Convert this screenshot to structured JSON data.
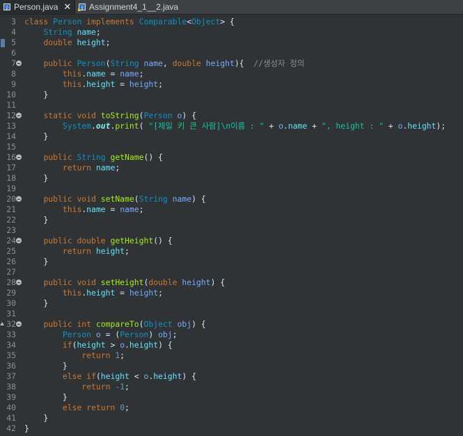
{
  "tabs": [
    {
      "label": "Person.java",
      "icon": "java-file-icon",
      "active": true,
      "close": "✕"
    },
    {
      "label": "Assignment4_1__2.java",
      "icon": "java-file-icon",
      "active": false
    }
  ],
  "lines": [
    {
      "n": "3",
      "parts": [
        [
          "kw",
          "class "
        ],
        [
          "type",
          "Person "
        ],
        [
          "kw",
          "implements "
        ],
        [
          "type",
          "Comparable"
        ],
        [
          "plain",
          "<"
        ],
        [
          "type",
          "Object"
        ],
        [
          "plain",
          "> {"
        ]
      ]
    },
    {
      "n": "4",
      "parts": [
        [
          "plain",
          "    "
        ],
        [
          "type",
          "String "
        ],
        [
          "fld",
          "name"
        ],
        [
          "plain",
          ";"
        ]
      ]
    },
    {
      "n": "5",
      "marker": true,
      "parts": [
        [
          "plain",
          "    "
        ],
        [
          "kw",
          "double "
        ],
        [
          "fld",
          "height"
        ],
        [
          "plain",
          ";"
        ]
      ]
    },
    {
      "n": "6",
      "parts": []
    },
    {
      "n": "7",
      "fold": true,
      "parts": [
        [
          "plain",
          "    "
        ],
        [
          "kw",
          "public "
        ],
        [
          "type",
          "Person"
        ],
        [
          "plain",
          "("
        ],
        [
          "type",
          "String "
        ],
        [
          "var",
          "name"
        ],
        [
          "plain",
          ", "
        ],
        [
          "kw",
          "double "
        ],
        [
          "var",
          "height"
        ],
        [
          "plain",
          "){  "
        ],
        [
          "cmt",
          "//생성자 정의"
        ]
      ]
    },
    {
      "n": "8",
      "parts": [
        [
          "plain",
          "        "
        ],
        [
          "kw",
          "this"
        ],
        [
          "plain",
          "."
        ],
        [
          "fld",
          "name"
        ],
        [
          "plain",
          " = "
        ],
        [
          "var",
          "name"
        ],
        [
          "plain",
          ";"
        ]
      ]
    },
    {
      "n": "9",
      "parts": [
        [
          "plain",
          "        "
        ],
        [
          "kw",
          "this"
        ],
        [
          "plain",
          "."
        ],
        [
          "fld",
          "height"
        ],
        [
          "plain",
          " = "
        ],
        [
          "var",
          "height"
        ],
        [
          "plain",
          ";"
        ]
      ]
    },
    {
      "n": "10",
      "parts": [
        [
          "plain",
          "    }"
        ]
      ]
    },
    {
      "n": "11",
      "parts": []
    },
    {
      "n": "12",
      "fold": true,
      "parts": [
        [
          "plain",
          "    "
        ],
        [
          "kw",
          "static "
        ],
        [
          "kw",
          "void "
        ],
        [
          "mth",
          "toString"
        ],
        [
          "plain",
          "("
        ],
        [
          "type",
          "Person "
        ],
        [
          "var",
          "o"
        ],
        [
          "plain",
          ") {"
        ]
      ]
    },
    {
      "n": "13",
      "parts": [
        [
          "plain",
          "        "
        ],
        [
          "type",
          "System"
        ],
        [
          "plain",
          "."
        ],
        [
          "it",
          "out"
        ],
        [
          "plain",
          "."
        ],
        [
          "mth",
          "print"
        ],
        [
          "plain",
          "( "
        ],
        [
          "str",
          "\"[제일 키 큰 사람]\\n이름 : \""
        ],
        [
          "plain",
          " + "
        ],
        [
          "var",
          "o"
        ],
        [
          "plain",
          "."
        ],
        [
          "fld",
          "name"
        ],
        [
          "plain",
          " + "
        ],
        [
          "str",
          "\", height : \""
        ],
        [
          "plain",
          " + "
        ],
        [
          "var",
          "o"
        ],
        [
          "plain",
          "."
        ],
        [
          "fld",
          "height"
        ],
        [
          "plain",
          ");"
        ]
      ]
    },
    {
      "n": "14",
      "parts": [
        [
          "plain",
          "    }"
        ]
      ]
    },
    {
      "n": "15",
      "parts": []
    },
    {
      "n": "16",
      "fold": true,
      "parts": [
        [
          "plain",
          "    "
        ],
        [
          "kw",
          "public "
        ],
        [
          "type",
          "String "
        ],
        [
          "mth",
          "getName"
        ],
        [
          "plain",
          "() {"
        ]
      ]
    },
    {
      "n": "17",
      "parts": [
        [
          "plain",
          "        "
        ],
        [
          "kw",
          "return "
        ],
        [
          "fld",
          "name"
        ],
        [
          "plain",
          ";"
        ]
      ]
    },
    {
      "n": "18",
      "parts": [
        [
          "plain",
          "    }"
        ]
      ]
    },
    {
      "n": "19",
      "parts": []
    },
    {
      "n": "20",
      "fold": true,
      "parts": [
        [
          "plain",
          "    "
        ],
        [
          "kw",
          "public "
        ],
        [
          "kw",
          "void "
        ],
        [
          "mth",
          "setName"
        ],
        [
          "plain",
          "("
        ],
        [
          "type",
          "String "
        ],
        [
          "var",
          "name"
        ],
        [
          "plain",
          ") {"
        ]
      ]
    },
    {
      "n": "21",
      "parts": [
        [
          "plain",
          "        "
        ],
        [
          "kw",
          "this"
        ],
        [
          "plain",
          "."
        ],
        [
          "fld",
          "name"
        ],
        [
          "plain",
          " = "
        ],
        [
          "var",
          "name"
        ],
        [
          "plain",
          ";"
        ]
      ]
    },
    {
      "n": "22",
      "parts": [
        [
          "plain",
          "    }"
        ]
      ]
    },
    {
      "n": "23",
      "parts": []
    },
    {
      "n": "24",
      "fold": true,
      "parts": [
        [
          "plain",
          "    "
        ],
        [
          "kw",
          "public "
        ],
        [
          "kw",
          "double "
        ],
        [
          "mth",
          "getHeight"
        ],
        [
          "plain",
          "() {"
        ]
      ]
    },
    {
      "n": "25",
      "parts": [
        [
          "plain",
          "        "
        ],
        [
          "kw",
          "return "
        ],
        [
          "fld",
          "height"
        ],
        [
          "plain",
          ";"
        ]
      ]
    },
    {
      "n": "26",
      "parts": [
        [
          "plain",
          "    }"
        ]
      ]
    },
    {
      "n": "27",
      "parts": []
    },
    {
      "n": "28",
      "fold": true,
      "parts": [
        [
          "plain",
          "    "
        ],
        [
          "kw",
          "public "
        ],
        [
          "kw",
          "void "
        ],
        [
          "mth",
          "setHeight"
        ],
        [
          "plain",
          "("
        ],
        [
          "kw",
          "double "
        ],
        [
          "var",
          "height"
        ],
        [
          "plain",
          ") {"
        ]
      ]
    },
    {
      "n": "29",
      "parts": [
        [
          "plain",
          "        "
        ],
        [
          "kw",
          "this"
        ],
        [
          "plain",
          "."
        ],
        [
          "fld",
          "height"
        ],
        [
          "plain",
          " = "
        ],
        [
          "var",
          "height"
        ],
        [
          "plain",
          ";"
        ]
      ]
    },
    {
      "n": "30",
      "parts": [
        [
          "plain",
          "    }"
        ]
      ]
    },
    {
      "n": "31",
      "parts": []
    },
    {
      "n": "32",
      "fold": true,
      "override": true,
      "parts": [
        [
          "plain",
          "    "
        ],
        [
          "kw",
          "public "
        ],
        [
          "kw",
          "int "
        ],
        [
          "mth",
          "compareTo"
        ],
        [
          "plain",
          "("
        ],
        [
          "type",
          "Object "
        ],
        [
          "var",
          "obj"
        ],
        [
          "plain",
          ") {"
        ]
      ]
    },
    {
      "n": "33",
      "parts": [
        [
          "plain",
          "        "
        ],
        [
          "type",
          "Person "
        ],
        [
          "var",
          "o"
        ],
        [
          "plain",
          " = ("
        ],
        [
          "type",
          "Person"
        ],
        [
          "plain",
          ") "
        ],
        [
          "var",
          "obj"
        ],
        [
          "plain",
          ";"
        ]
      ]
    },
    {
      "n": "34",
      "parts": [
        [
          "plain",
          "        "
        ],
        [
          "kw",
          "if"
        ],
        [
          "plain",
          "("
        ],
        [
          "fld",
          "height"
        ],
        [
          "plain",
          " > "
        ],
        [
          "var",
          "o"
        ],
        [
          "plain",
          "."
        ],
        [
          "fld",
          "height"
        ],
        [
          "plain",
          ") {"
        ]
      ]
    },
    {
      "n": "35",
      "parts": [
        [
          "plain",
          "            "
        ],
        [
          "kw",
          "return "
        ],
        [
          "num",
          "1"
        ],
        [
          "plain",
          ";"
        ]
      ]
    },
    {
      "n": "36",
      "parts": [
        [
          "plain",
          "        }"
        ]
      ]
    },
    {
      "n": "37",
      "parts": [
        [
          "plain",
          "        "
        ],
        [
          "kw",
          "else "
        ],
        [
          "kw",
          "if"
        ],
        [
          "plain",
          "("
        ],
        [
          "fld",
          "height"
        ],
        [
          "plain",
          " < "
        ],
        [
          "var",
          "o"
        ],
        [
          "plain",
          "."
        ],
        [
          "fld",
          "height"
        ],
        [
          "plain",
          ") {"
        ]
      ]
    },
    {
      "n": "38",
      "parts": [
        [
          "plain",
          "            "
        ],
        [
          "kw",
          "return "
        ],
        [
          "num",
          "-1"
        ],
        [
          "plain",
          ";"
        ]
      ]
    },
    {
      "n": "39",
      "parts": [
        [
          "plain",
          "        }"
        ]
      ]
    },
    {
      "n": "40",
      "parts": [
        [
          "plain",
          "        "
        ],
        [
          "kw",
          "else "
        ],
        [
          "kw",
          "return "
        ],
        [
          "num",
          "0"
        ],
        [
          "plain",
          ";"
        ]
      ]
    },
    {
      "n": "41",
      "parts": [
        [
          "plain",
          "    }"
        ]
      ]
    },
    {
      "n": "42",
      "parts": [
        [
          "plain",
          "}"
        ]
      ]
    }
  ]
}
